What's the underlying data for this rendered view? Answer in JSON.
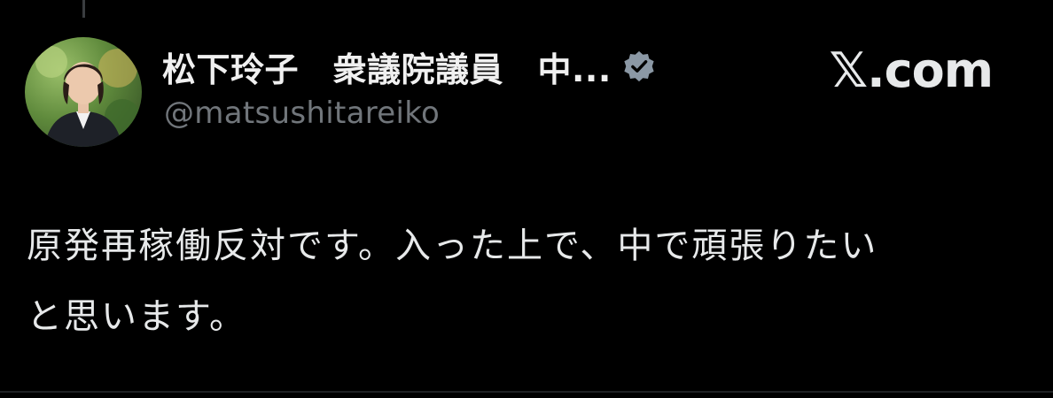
{
  "post": {
    "author": {
      "display_name": "松下玲子　衆議院議員　中...",
      "handle": "@matsushitareiko",
      "verified": true,
      "verified_badge_icon": "verified-badge-icon",
      "verified_badge_color": "#8b98a5"
    },
    "site_logo": "𝕏.com",
    "text_lines": [
      "原発再稼働反対です。入った上で、中で頑張りたい",
      "と思います。"
    ]
  },
  "colors": {
    "background": "#000000",
    "text": "#e7e9ea",
    "secondary_text": "#71767b"
  }
}
